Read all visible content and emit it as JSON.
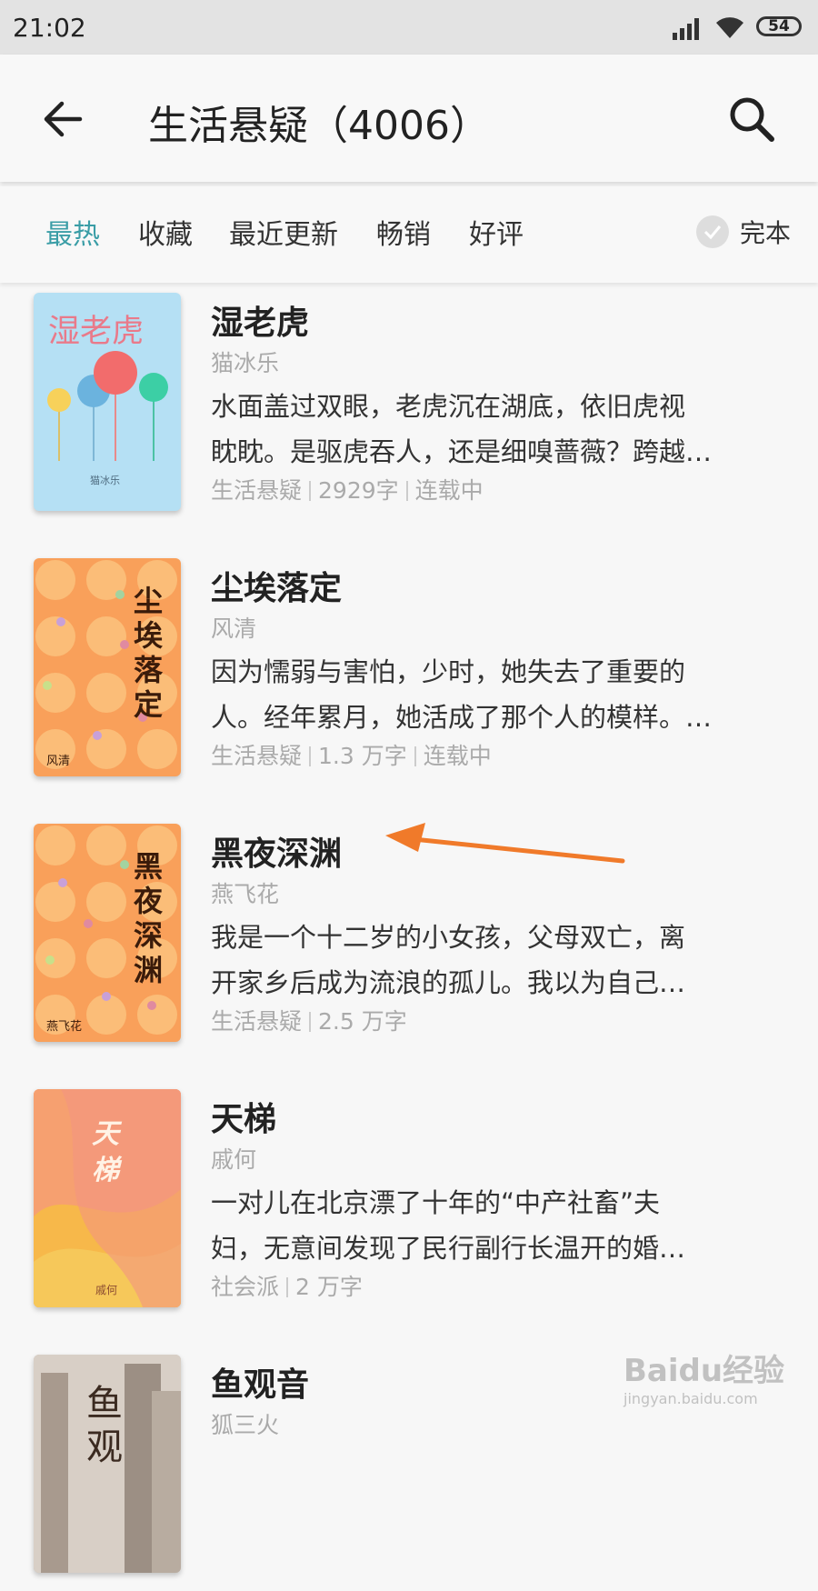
{
  "status_bar": {
    "time": "21:02",
    "battery": "54"
  },
  "header": {
    "title": "生活悬疑（4006）"
  },
  "tabs": [
    {
      "label": "最热",
      "active": true
    },
    {
      "label": "收藏",
      "active": false
    },
    {
      "label": "最近更新",
      "active": false
    },
    {
      "label": "畅销",
      "active": false
    },
    {
      "label": "好评",
      "active": false
    }
  ],
  "complete_toggle": {
    "label": "完本"
  },
  "books": [
    {
      "title": "湿老虎",
      "author": "猫冰乐",
      "desc1": "水面盖过双眼，老虎沉在湖底，依旧虎视",
      "desc2": "眈眈。是驱虎吞人，还是细嗅蔷薇？跨越…",
      "category": "生活悬疑",
      "words": "2929字",
      "status": "连载中",
      "cover_title": "湿老虎",
      "cover_author": "猫冰乐"
    },
    {
      "title": "尘埃落定",
      "author": "风清",
      "desc1": "因为懦弱与害怕，少时，她失去了重要的",
      "desc2": "人。经年累月，她活成了那个人的模样。…",
      "category": "生活悬疑",
      "words": "1.3 万字",
      "status": "连载中",
      "cover_title": "尘埃落定",
      "cover_author": "风清"
    },
    {
      "title": "黑夜深渊",
      "author": "燕飞花",
      "desc1": "我是一个十二岁的小女孩，父母双亡，离",
      "desc2": "开家乡后成为流浪的孤儿。我以为自己…",
      "category": "生活悬疑",
      "words": "2.5 万字",
      "status": "",
      "cover_title": "黑夜深渊",
      "cover_author": "燕飞花"
    },
    {
      "title": "天梯",
      "author": "戚何",
      "desc1": "一对儿在北京漂了十年的“中产社畜”夫",
      "desc2": "妇，无意间发现了民行副行长温开的婚…",
      "category": "社会派",
      "words": "2 万字",
      "status": "",
      "cover_title": "天梯",
      "cover_author": "戚何"
    },
    {
      "title": "鱼观音",
      "author": "狐三火",
      "desc1": "",
      "desc2": "",
      "category": "",
      "words": "",
      "status": "",
      "cover_title": "鱼观"
    }
  ],
  "watermark": {
    "text": "Baidu经验",
    "url": "jingyan.baidu.com"
  },
  "colors": {
    "accent": "#3a9da6",
    "arrow": "#f07a2a",
    "orange_cover": "#f9a05a"
  }
}
